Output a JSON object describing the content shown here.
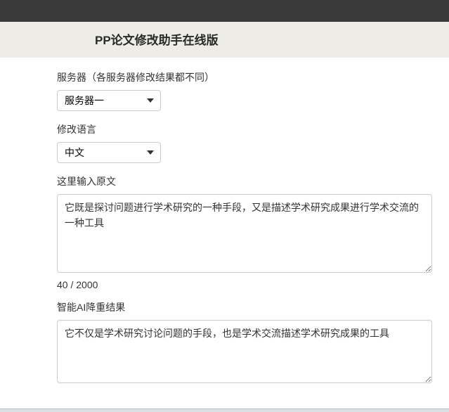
{
  "header": {
    "title": "PP论文修改助手在线版"
  },
  "form": {
    "server": {
      "label": "服务器（各服务器修改结果都不同）",
      "selected": "服务器一",
      "options": [
        "服务器一"
      ]
    },
    "language": {
      "label": "修改语言",
      "selected": "中文",
      "options": [
        "中文"
      ]
    },
    "input": {
      "label": "这里输入原文",
      "value": "它既是探讨问题进行学术研究的一种手段，又是描述学术研究成果进行学术交流的一种工具",
      "counter": "40 / 2000"
    },
    "output": {
      "label": "智能AI降重结果",
      "value": "它不仅是学术研究讨论问题的手段，也是学术交流描述学术研究成果的工具"
    }
  }
}
